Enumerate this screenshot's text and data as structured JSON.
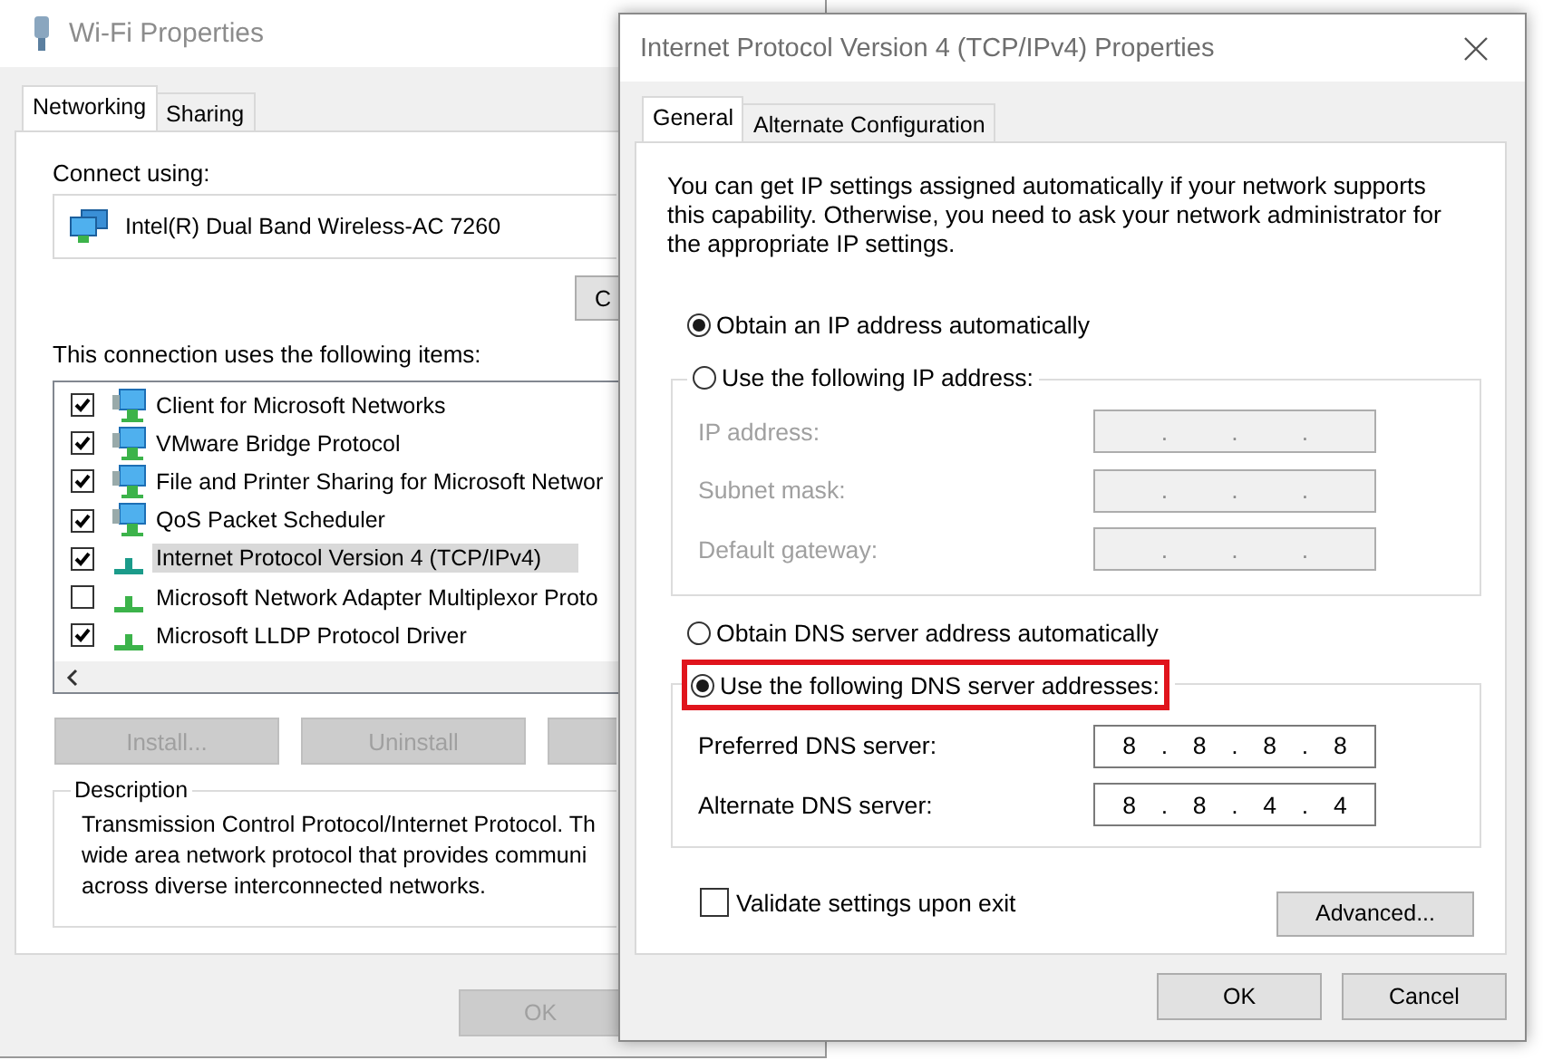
{
  "wifi_window": {
    "title": "Wi-Fi Properties",
    "tabs": [
      {
        "label": "Networking",
        "selected": true
      },
      {
        "label": "Sharing",
        "selected": false
      }
    ],
    "connect_using_label": "Connect using:",
    "adapter": "Intel(R) Dual Band Wireless-AC 7260",
    "configure_button": "C",
    "items_label": "This connection uses the following items:",
    "items": [
      {
        "label": "Client for Microsoft Networks",
        "kind": "service",
        "checked": true,
        "selected": false
      },
      {
        "label": "VMware Bridge Protocol",
        "kind": "service",
        "checked": true,
        "selected": false
      },
      {
        "label": "File and Printer Sharing for Microsoft Networ",
        "kind": "service",
        "checked": true,
        "selected": false
      },
      {
        "label": "QoS Packet Scheduler",
        "kind": "service",
        "checked": true,
        "selected": false
      },
      {
        "label": "Internet Protocol Version 4 (TCP/IPv4)",
        "kind": "protocol",
        "checked": true,
        "selected": true
      },
      {
        "label": "Microsoft Network Adapter Multiplexor Proto",
        "kind": "protocol",
        "checked": false,
        "selected": false
      },
      {
        "label": "Microsoft LLDP Protocol Driver",
        "kind": "protocol",
        "checked": true,
        "selected": false
      }
    ],
    "buttons": [
      {
        "label": "Install...",
        "disabled": true
      },
      {
        "label": "Uninstall",
        "disabled": true
      },
      {
        "disabled": true
      }
    ],
    "description_title": "Description",
    "description": "Transmission Control Protocol/Internet Protocol. Th\nwide area network protocol that provides communi\nacross diverse interconnected networks.",
    "ok_button": {
      "label": "OK",
      "disabled": true
    }
  },
  "ipv4_window": {
    "title": "Internet Protocol Version 4 (TCP/IPv4) Properties",
    "tabs": [
      {
        "label": "General",
        "selected": true
      },
      {
        "label": "Alternate Configuration",
        "selected": false
      }
    ],
    "intro": "You can get IP settings assigned automatically if your network supports this capability. Otherwise, you need to ask your network administrator for the appropriate IP settings.",
    "ip_separator": ".",
    "ip_options": [
      {
        "label": "Obtain an IP address automatically",
        "selected": true,
        "highlighted": false
      },
      {
        "label": "Use the following IP address:",
        "selected": false,
        "highlighted": false
      }
    ],
    "ip_fields": [
      {
        "label": "IP address:",
        "disabled": true
      },
      {
        "label": "Subnet mask:",
        "disabled": true
      },
      {
        "label": "Default gateway:",
        "disabled": true
      }
    ],
    "dns_options": [
      {
        "label": "Obtain DNS server address automatically",
        "selected": false,
        "highlighted": false
      },
      {
        "label": "Use the following DNS server addresses:",
        "selected": true,
        "highlighted": true
      }
    ],
    "dns_fields": [
      {
        "label": "Preferred DNS server:",
        "disabled": false,
        "octets": [
          "8",
          "8",
          "8",
          "8"
        ]
      },
      {
        "label": "Alternate DNS server:",
        "disabled": false,
        "octets": [
          "8",
          "8",
          "4",
          "4"
        ]
      }
    ],
    "validate": {
      "label": "Validate settings upon exit",
      "checked": false
    },
    "advanced_button": "Advanced...",
    "ok_button": "OK",
    "cancel_button": "Cancel"
  }
}
